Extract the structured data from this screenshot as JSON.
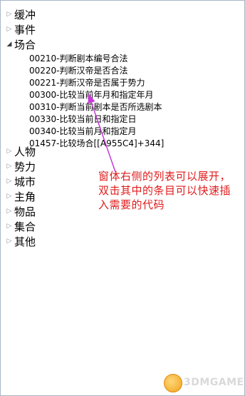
{
  "tree": {
    "categories": [
      {
        "label": "缓冲",
        "expanded": false
      },
      {
        "label": "事件",
        "expanded": false
      },
      {
        "label": "场合",
        "expanded": true
      },
      {
        "label": "人物",
        "expanded": false
      },
      {
        "label": "势力",
        "expanded": false
      },
      {
        "label": "城市",
        "expanded": false
      },
      {
        "label": "主角",
        "expanded": false
      },
      {
        "label": "物品",
        "expanded": false
      },
      {
        "label": "集合",
        "expanded": false
      },
      {
        "label": "其他",
        "expanded": false
      }
    ],
    "expanded_children": [
      "00210-判断剧本编号合法",
      "00220-判断汉帝是否合法",
      "00221-判断汉帝是否属于势力",
      "00300-比较当前年月和指定年月",
      "00310-判断当前剧本是否所选剧本",
      "00330-比较当前日和指定日",
      "00340-比较当前月和指定月",
      "01457-比较场合[[A955C4]+344]"
    ]
  },
  "annotation": {
    "lines": [
      "窗体右侧的列表可以展开，",
      "双击其中的条目可以快速插",
      "入需要的代码"
    ],
    "color": "#e01c1c"
  },
  "arrow_color": "#c83ad8",
  "watermark": {
    "text": "3DMGAME",
    "logo": "game-mascot-logo"
  }
}
